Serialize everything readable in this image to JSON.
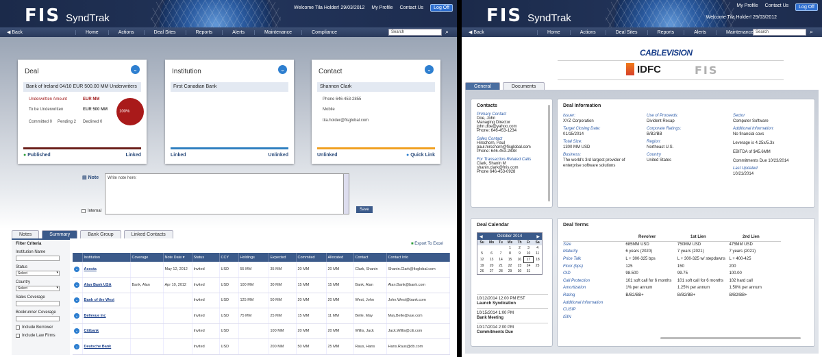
{
  "header": {
    "brand": "FIS",
    "product": "SyndTrak",
    "left_welcome": "Welcome Tila Holder! 29/03/2012",
    "right_welcome": "Welcome Tila Holder! 29/03/2012",
    "my_profile": "My Profile",
    "contact_us": "Contact Us",
    "logoff": "Log Off"
  },
  "nav": {
    "back": "Back",
    "left_items": [
      "Home",
      "Actions",
      "Deal Sites",
      "Reports",
      "Alerts",
      "Maintenance",
      "Compliance"
    ],
    "right_items": [
      "Home",
      "Actions",
      "Deal Sites",
      "Reports",
      "Alerts",
      "Maintenance"
    ],
    "search_placeholder": "Search"
  },
  "cards": {
    "deal": {
      "title": "Deal",
      "name": "Bank of Ireland 04/10 EUR 500.00 MM Underwriters",
      "underwritten_label": "Underwritten Amount",
      "underwritten_value": "EUR MM",
      "to_be_label": "To be Underwritten",
      "to_be_value": "EUR 500 MM",
      "pie_label": "100%",
      "committed": "Committed 0",
      "pending": "Pending 2",
      "declined": "Declined 0",
      "status_left": "Published",
      "status_right": "Linked",
      "line_color": "#6b1f1a"
    },
    "institution": {
      "title": "Institution",
      "name": "First Canadian Bank",
      "status_left": "Linked",
      "status_right": "Unlinked",
      "line_color": "#2f7fc0"
    },
    "contact": {
      "title": "Contact",
      "name": "Shannon Clark",
      "phone": "Phone   646-453-2855",
      "mobile": "Mobile",
      "email": "tila.holder@fisglobal.com",
      "status_left": "Unlinked",
      "status_right": "Quick Link",
      "line_color": "#f0a020"
    }
  },
  "note": {
    "label": "Note",
    "placeholder": "Write note here:",
    "internal": "Internal",
    "save": "Save"
  },
  "left_tabs": [
    "Notes",
    "Summary",
    "Bank Group",
    "Linked Contacts"
  ],
  "export": "Export To Excel",
  "filter": {
    "title": "Filter Criteria",
    "institution_name": "Institution Name",
    "status": "Status",
    "status_value": "Select",
    "country": "Country",
    "country_value": "Select",
    "sales_coverage": "Sales Coverage",
    "bookrunner_coverage": "Bookrunner Coverage",
    "include_borrower": "Include Borrower",
    "include_law_firms": "Include Law Firms"
  },
  "grid": {
    "columns": [
      "",
      "Institution",
      "Coverage",
      "Note Date ▾",
      "Status",
      "CCY",
      "Holdings",
      "Expected",
      "Commited",
      "Allocated",
      "Contact",
      "Contact Info"
    ],
    "rows": [
      [
        "Acosta",
        "",
        "May 12, 2012",
        "Invited",
        "USD",
        "55 MM",
        "35 MM",
        "20 MM",
        "20 MM",
        "Clark, Shanin",
        "Shanin.Clark@fisglobal.com"
      ],
      [
        "Alan Bank USA",
        "Bank, Alan",
        "Apr 10, 2012",
        "Invited",
        "USD",
        "100 MM",
        "30 MM",
        "15 MM",
        "15 MM",
        "Bank, Alan",
        "Alan.Bank@bank.com"
      ],
      [
        "Bank of the West",
        "",
        "",
        "Invited",
        "USD",
        "125 MM",
        "50 MM",
        "20 MM",
        "20 MM",
        "West, John",
        "John.West@bank.com"
      ],
      [
        "Bellevue Inc",
        "",
        "",
        "Invited",
        "USD",
        "75 MM",
        "25 MM",
        "15 MM",
        "11 MM",
        "Belle, May",
        "May.Belle@vue.com"
      ],
      [
        "Citibank",
        "",
        "",
        "Invited",
        "USD",
        "",
        "100 MM",
        "20 MM",
        "20 MM",
        "Willis, Jack",
        "Jack.Willis@citi.com"
      ],
      [
        "Deutsche Bank",
        "",
        "",
        "Invited",
        "USD",
        "",
        "200 MM",
        "50 MM",
        "25 MM",
        "Raus, Hans",
        "Hans.Raus@db.com"
      ]
    ]
  },
  "right": {
    "logos": {
      "cablevision": "CABLEVISION",
      "idfc": "IDFC",
      "fis": "FIS"
    },
    "tabs": [
      "General",
      "Documents"
    ],
    "contacts": {
      "title": "Contacts",
      "primary_label": "Primary Contact",
      "primary": [
        "Doe, John",
        "Managing Director",
        "john.doe@yahoo.com",
        "Phone: 646-453-1234"
      ],
      "sales_label": "Sales Contact",
      "sales": [
        "Hirschorn, Paul",
        "paul.hirschorn@fisglobal.com",
        "Phone: 646-453-2838"
      ],
      "trans_label": "For Transaction-Related Calls",
      "trans": [
        "Clark, Shanin M",
        "shanin.clark@fnis.com",
        "Phone 646-453-0928"
      ]
    },
    "deal_info": {
      "title": "Deal Information",
      "issuer_l": "Issuer:",
      "issuer": "XYZ Corporation",
      "close_l": "Target Closing Date:",
      "close": "01/15/2014",
      "size_l": "Total Size:",
      "size": "1300 MM USD",
      "business_l": "Business:",
      "business": "The world's 3rd largest provider of enterprise software solutions",
      "use_l": "Use of Proceeds:",
      "use": "Divident Recap",
      "rating_l": "Corporate Ratings:",
      "rating": "B/B2/BB",
      "region_l": "Region:",
      "region": "Northeast U.S.",
      "country_l": "Country",
      "country": "United States",
      "sector_l": "Sector",
      "sector": "Computer Software",
      "addl_l": "Additional Information:",
      "addl": "No financial covs",
      "leverage": "Leverage is 4.25x/5.3x",
      "ebitda": "EBITDA of $45.6MM",
      "commit": "Commitments Due 10/23/2014",
      "updated_l": "Last Updated",
      "updated": "10/21/2014"
    },
    "calendar": {
      "title": "Deal Calendar",
      "month": "October 2014",
      "days": [
        "Su",
        "Mo",
        "Tu",
        "We",
        "Th",
        "Fr",
        "Sa"
      ],
      "weeks": [
        [
          "",
          "",
          "",
          "1",
          "2",
          "3",
          "4"
        ],
        [
          "5",
          "6",
          "7",
          "8",
          "9",
          "10",
          "11"
        ],
        [
          "12",
          "13",
          "14",
          "15",
          "16",
          "17",
          "18"
        ],
        [
          "19",
          "20",
          "21",
          "22",
          "23",
          "24",
          "25"
        ],
        [
          "26",
          "27",
          "28",
          "29",
          "30",
          "31",
          ""
        ]
      ],
      "selected": "17",
      "events": [
        {
          "when": "10/12/2014 12:00 PM EST",
          "what": "Launch Syndication"
        },
        {
          "when": "10/15/2014 1:00 PM",
          "what": "Bank Meeting"
        },
        {
          "when": "10/17/2014 2:00 PM",
          "what": "Commitments Due"
        }
      ]
    },
    "terms": {
      "title": "Deal Terms",
      "cols": [
        "Revolver",
        "1st Lien",
        "2nd Lien"
      ],
      "rows": [
        [
          "Size",
          "685MM USD",
          "750MM USD",
          "475MM USD"
        ],
        [
          "Maturity",
          "6 years (2020)",
          "7 years (2021)",
          "7 years (2021)"
        ],
        [
          "Price Talk",
          "L + 300-325 bps",
          "L + 300-325 w/ stepdowns",
          "L + 400-425"
        ],
        [
          "Floor (bps)",
          "125",
          "150",
          "200"
        ],
        [
          "OID",
          "98.500",
          "99.75",
          "100.00"
        ],
        [
          "Call Protection",
          "101 soft call for 6 months",
          "101 soft call for 6 months",
          "102 hard call"
        ],
        [
          "Amortization",
          "1% per annum",
          "1.25% per annum",
          "1.50% per annum"
        ],
        [
          "Rating",
          "B/B2/BB+",
          "B/B2/BB+",
          "B/B2/BB+"
        ],
        [
          "Additional Information",
          "",
          "",
          ""
        ],
        [
          "CUSIP",
          "",
          "",
          ""
        ],
        [
          "ISIN",
          "",
          "",
          ""
        ]
      ]
    }
  }
}
